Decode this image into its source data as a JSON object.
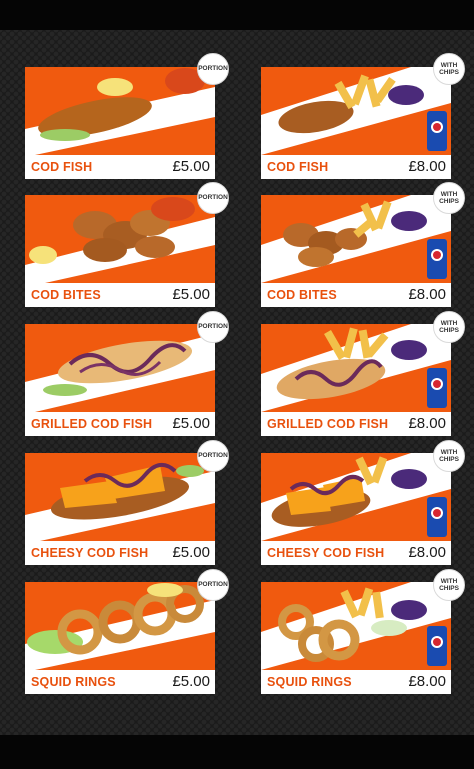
{
  "menu": {
    "left": [
      {
        "name": "COD FISH",
        "price": "£5.00",
        "badge": "PORTION"
      },
      {
        "name": "COD BITES",
        "price": "£5.00",
        "badge": "PORTION"
      },
      {
        "name": "GRILLED COD FISH",
        "price": "£5.00",
        "badge": "PORTION"
      },
      {
        "name": "CHEESY COD FISH",
        "price": "£5.00",
        "badge": "PORTION"
      },
      {
        "name": "SQUID RINGS",
        "price": "£5.00",
        "badge": "PORTION"
      }
    ],
    "right": [
      {
        "name": "COD FISH",
        "price": "£8.00",
        "badge": "WITH CHIPS"
      },
      {
        "name": "COD BITES",
        "price": "£8.00",
        "badge": "WITH CHIPS"
      },
      {
        "name": "GRILLED COD FISH",
        "price": "£8.00",
        "badge": "WITH CHIPS"
      },
      {
        "name": "CHEESY COD FISH",
        "price": "£8.00",
        "badge": "WITH CHIPS"
      },
      {
        "name": "SQUID RINGS",
        "price": "£8.00",
        "badge": "WITH CHIPS"
      }
    ]
  },
  "colors": {
    "accent_orange": "#f05a0f",
    "label_text": "#e8510e",
    "background": "#1b1b1b"
  }
}
